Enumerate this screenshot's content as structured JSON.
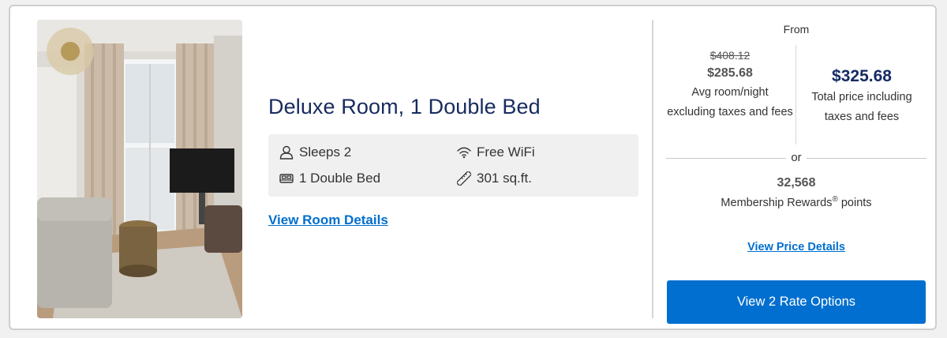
{
  "room": {
    "title": "Deluxe Room, 1 Double Bed",
    "amenities": {
      "sleeps": {
        "label": "Sleeps 2",
        "icon": "person-icon"
      },
      "bed": {
        "label": "1 Double Bed",
        "icon": "bed-icon"
      },
      "wifi": {
        "label": "Free WiFi",
        "icon": "wifi-icon"
      },
      "size": {
        "label": "301 sq.ft.",
        "icon": "ruler-icon"
      }
    },
    "details_link": "View Room Details"
  },
  "pricing": {
    "from_label": "From",
    "original_price": "$408.12",
    "avg_price": "$285.68",
    "avg_label": "Avg room/night excluding taxes and fees",
    "total_price": "$325.68",
    "total_label": "Total price including taxes and fees",
    "or_label": "or",
    "points_value": "32,568",
    "points_label_main": "Membership Rewards",
    "points_label_mark": "®",
    "points_label_suffix": " points",
    "price_details_link": "View Price Details",
    "rate_button": "View 2 Rate Options"
  },
  "colors": {
    "accent": "#006fcf",
    "title": "#172b5e",
    "total_price": "#152b63"
  }
}
